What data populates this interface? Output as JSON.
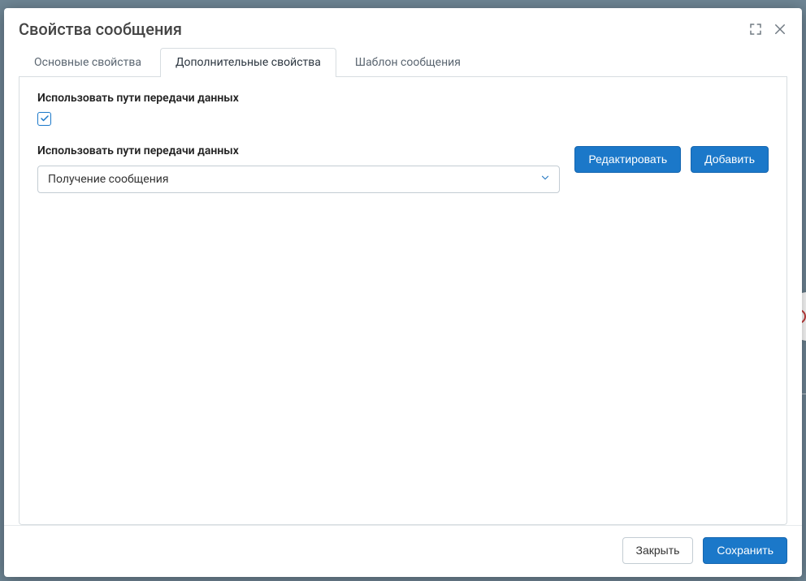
{
  "header": {
    "title": "Свойства сообщения"
  },
  "tabs": {
    "basic": "Основные свойства",
    "additional": "Дополнительные свойства",
    "template": "Шаблон сообщения"
  },
  "form": {
    "use_paths_label_1": "Использовать пути передачи данных",
    "use_paths_checked": true,
    "use_paths_label_2": "Использовать пути передачи данных",
    "select_value": "Получение сообщения",
    "edit_button": "Редактировать",
    "add_button": "Добавить"
  },
  "footer": {
    "close": "Закрыть",
    "save": "Сохранить"
  }
}
